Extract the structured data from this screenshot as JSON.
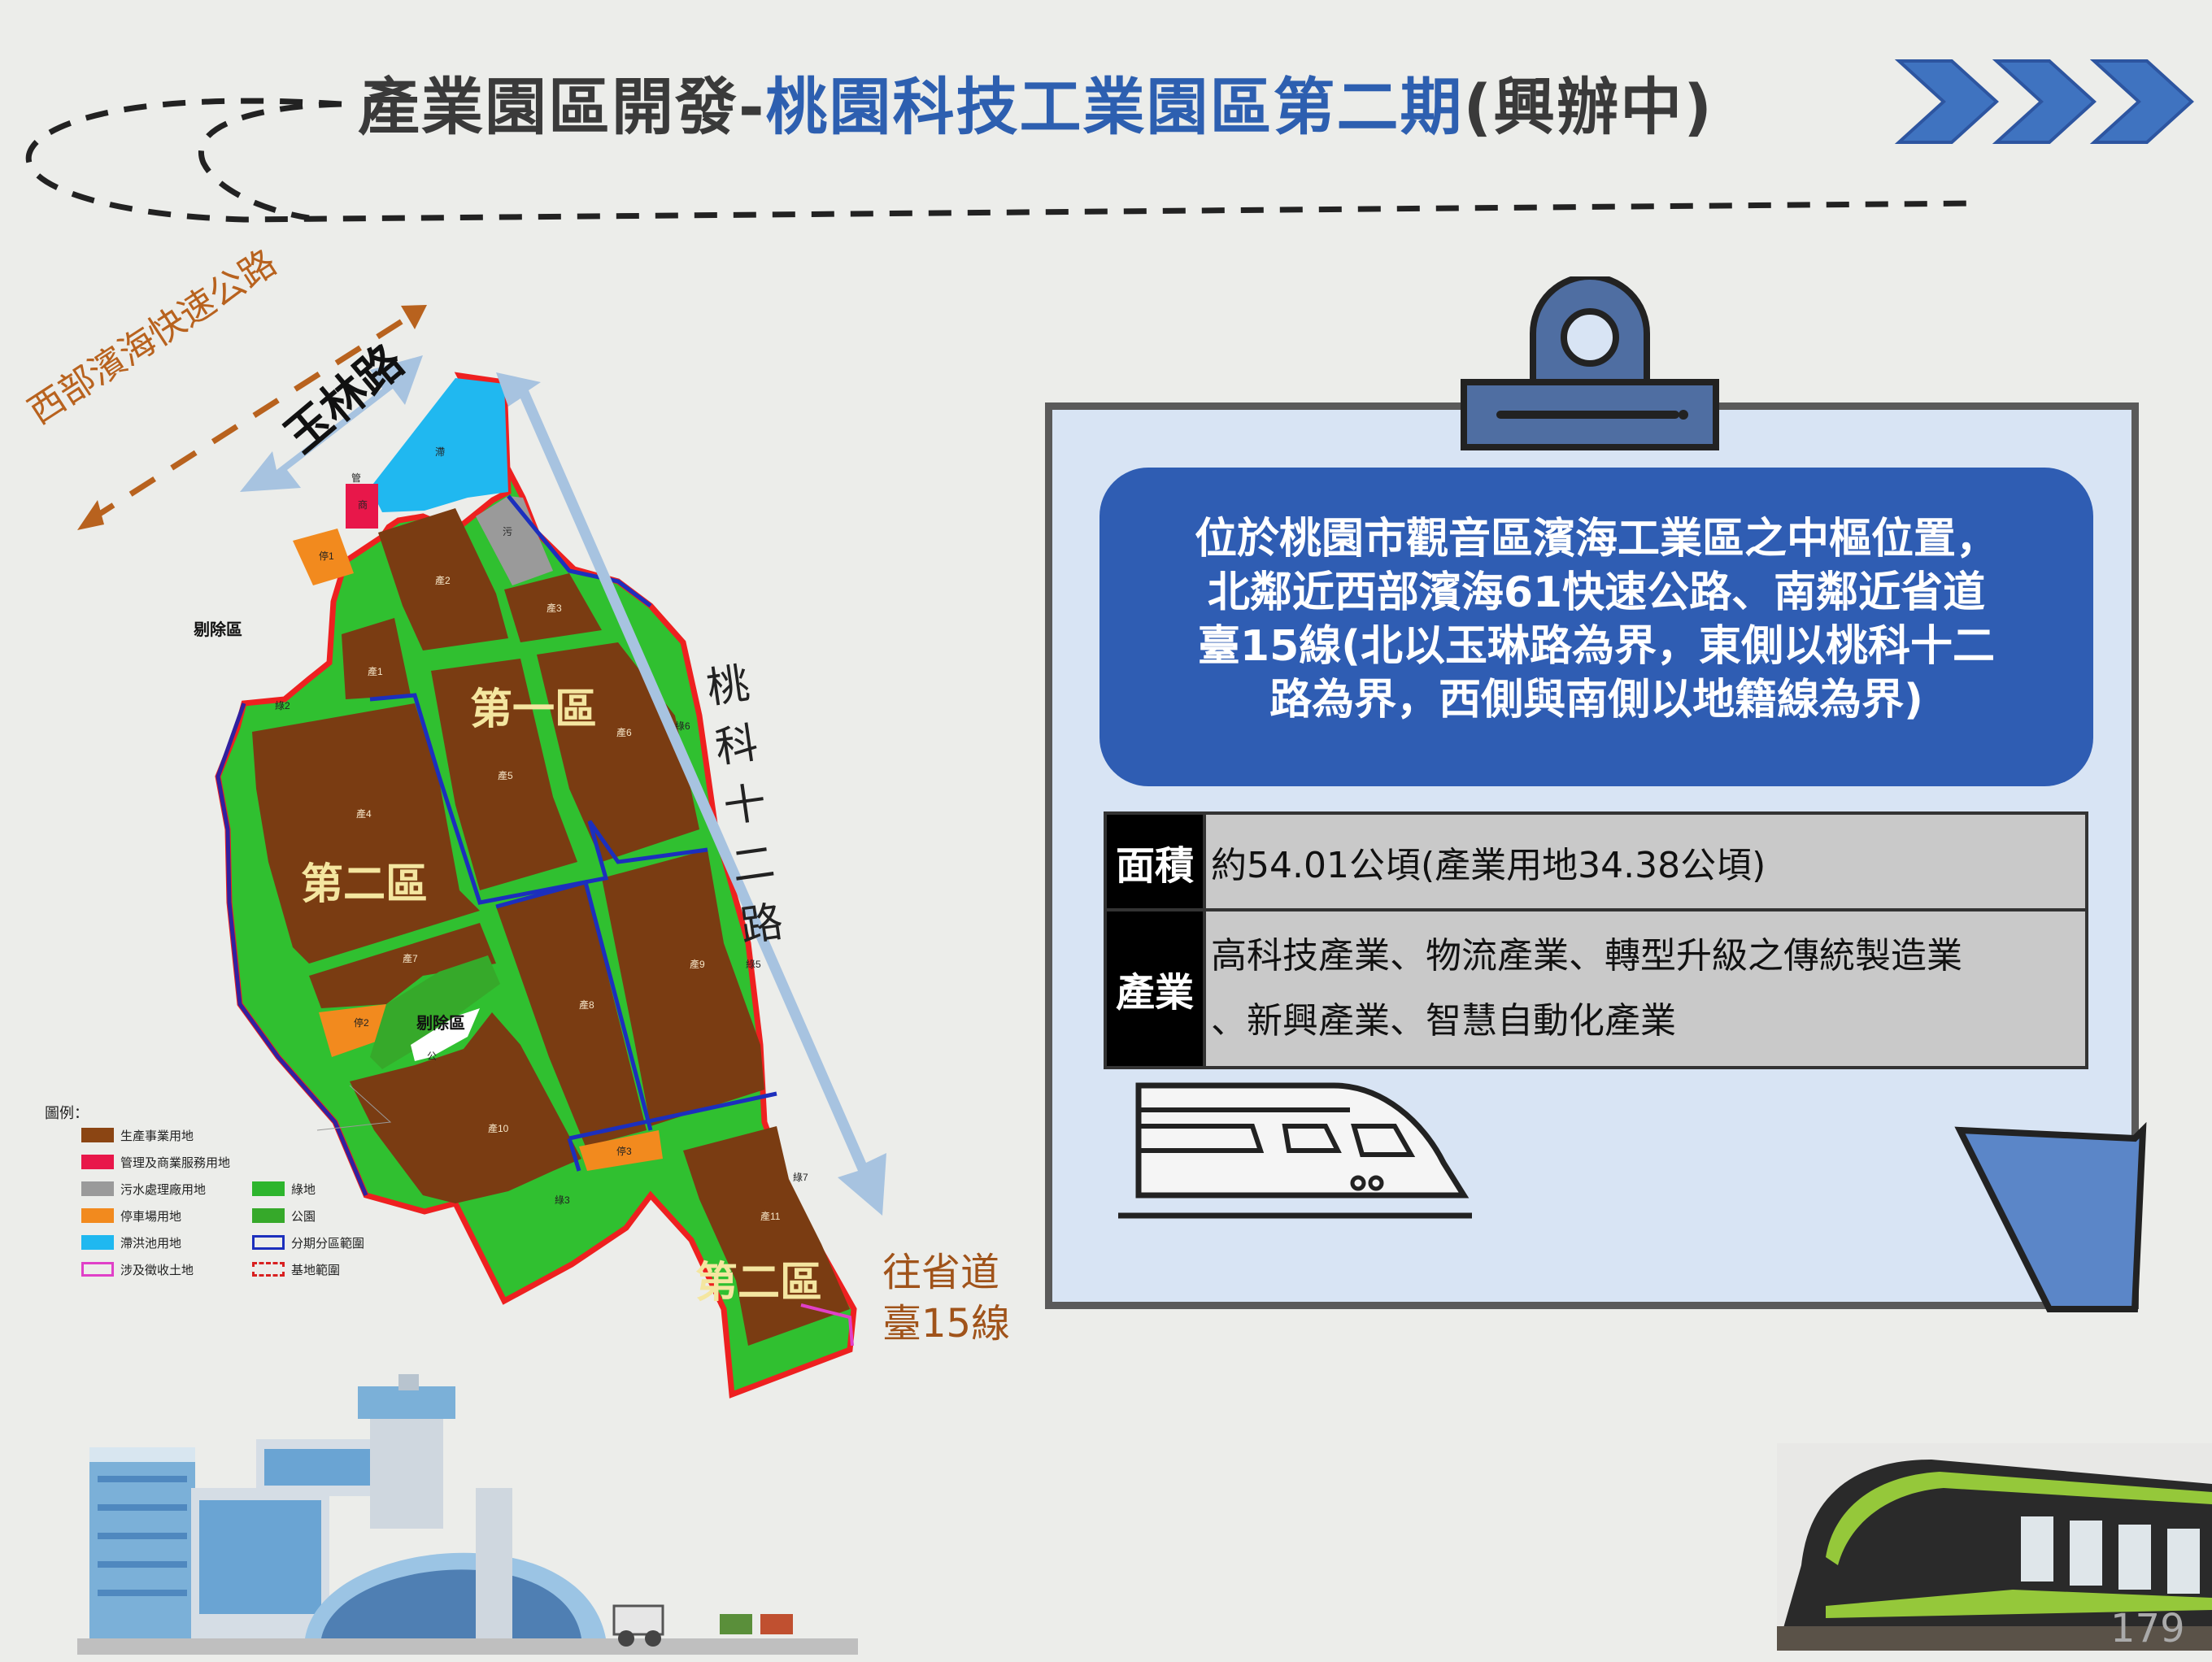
{
  "title": {
    "part1": "產業園區開發-",
    "part2": "桃園科技工業園區第二期",
    "part3": "(興辦中)"
  },
  "description_lines": [
    "位於桃園市觀音區濱海工業區之中樞位置，",
    "北鄰近西部濱海61快速公路、南鄰近省道",
    "臺15線(北以玉琳路為界，東側以桃科十二",
    "路為界，西側與南側以地籍線為界)"
  ],
  "table": {
    "area_label": "面積",
    "area_value": "約54.01公頃(產業用地34.38公頃)",
    "industry_label": "產業",
    "industry_line1": "高科技產業、物流產業、轉型升級之傳統製造業",
    "industry_line2": "、新興產業、智慧自動化產業"
  },
  "map": {
    "highway": "西部濱海快速公路",
    "yulin_road": "玉林路",
    "taoke12_road": "桃科十二路",
    "to_route15_line1": "往省道",
    "to_route15_line2": "臺15線",
    "zone1": "第一區",
    "zone2_west": "第二區",
    "zone2_south": "第二區",
    "excluded_west": "剔除區",
    "excluded_center": "剔除區",
    "parcels": {
      "gen2": "產2",
      "gen3": "產3",
      "gen1": "產1",
      "gen4": "產4",
      "gen5": "產5",
      "gen6": "產6",
      "gen7": "產7",
      "gen8": "產8",
      "gen9": "產9",
      "gen10": "產10",
      "gen11": "產11",
      "park1": "停1",
      "park2": "停2",
      "park3": "停3",
      "green2": "綠2",
      "green3": "綠3",
      "green6": "綠6",
      "green5": "綠5",
      "green7": "綠7",
      "public": "公",
      "sewage": "污",
      "detention": "滯",
      "commerce": "商",
      "mgmt": "管"
    }
  },
  "legend": {
    "title": "圖例：",
    "items": [
      {
        "label": "生產事業用地",
        "color": "#8b4513"
      },
      {
        "label": "管理及商業服務用地",
        "color": "#e8174a"
      },
      {
        "label": "污水處理廠用地",
        "color": "#9a9a9a"
      },
      {
        "label": "綠地",
        "color": "#2db52d"
      },
      {
        "label": "停車場用地",
        "color": "#f28a1e"
      },
      {
        "label": "公園",
        "color": "#36a92a"
      },
      {
        "label": "滯洪池用地",
        "color": "#1fb8f0"
      },
      {
        "label": "分期分區範圍",
        "color": "#1c2fbd"
      },
      {
        "label": "涉及徵收土地",
        "color": "#e040c8"
      },
      {
        "label": "基地範圍",
        "color": "#d82020"
      }
    ]
  },
  "page_number": "179"
}
